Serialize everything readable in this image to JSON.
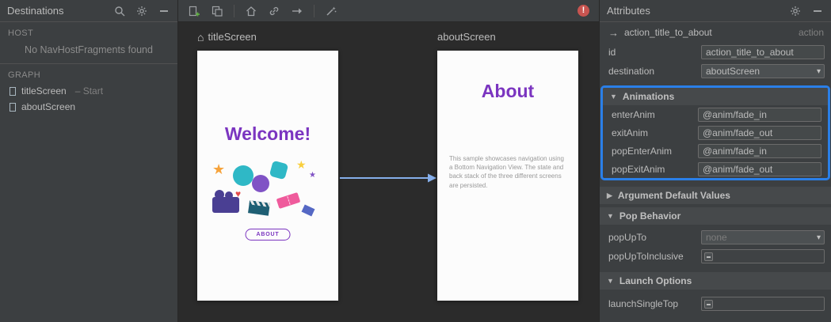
{
  "colors": {
    "panel_bg": "#3c3f41",
    "canvas_bg": "#2b2b2b",
    "accent_purple": "#7b35c0",
    "arrow_blue": "#85aeea",
    "highlight_blue": "#2a7fe8",
    "error_red": "#c75450",
    "text": "#bbbbbb",
    "text_dim": "#808080"
  },
  "icons": {
    "home": "⌂",
    "action_arrow": "→",
    "caret_down": "▾",
    "section_open": "▼",
    "section_closed": "▶",
    "error": "!",
    "star": "★",
    "heart": "♥"
  },
  "destinations_panel": {
    "title": "Destinations",
    "host_section": "HOST",
    "host_empty_message": "No NavHostFragments found",
    "graph_section": "GRAPH",
    "graph_items": [
      {
        "label": "titleScreen",
        "suffix": "– Start"
      },
      {
        "label": "aboutScreen",
        "suffix": ""
      }
    ]
  },
  "canvas": {
    "title_screen": {
      "name": "titleScreen",
      "heading": "Welcome!",
      "button_label": "ABOUT"
    },
    "about_screen": {
      "name": "aboutScreen",
      "heading": "About",
      "body_text": "This sample showcases navigation using a Bottom Navigation View. The state and back stack of the three different screens are persisted."
    }
  },
  "attributes_panel": {
    "title": "Attributes",
    "action": {
      "name": "action_title_to_about",
      "type": "action"
    },
    "id_row": {
      "label": "id",
      "value": "action_title_to_about"
    },
    "destination_row": {
      "label": "destination",
      "value": "aboutScreen"
    },
    "animations": {
      "header": "Animations",
      "rows": [
        {
          "label": "enterAnim",
          "value": "@anim/fade_in"
        },
        {
          "label": "exitAnim",
          "value": "@anim/fade_out"
        },
        {
          "label": "popEnterAnim",
          "value": "@anim/fade_in"
        },
        {
          "label": "popExitAnim",
          "value": "@anim/fade_out"
        }
      ]
    },
    "argument_defaults": {
      "header": "Argument Default Values"
    },
    "pop_behavior": {
      "header": "Pop Behavior",
      "pop_up_to": {
        "label": "popUpTo",
        "value": "none"
      },
      "pop_up_to_inclusive": {
        "label": "popUpToInclusive"
      }
    },
    "launch_options": {
      "header": "Launch Options",
      "launch_single_top": {
        "label": "launchSingleTop"
      }
    }
  }
}
